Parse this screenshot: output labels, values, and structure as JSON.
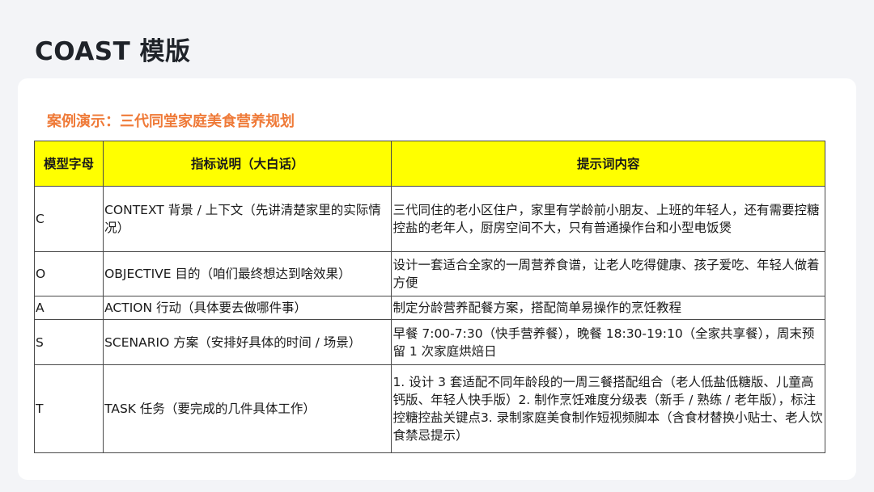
{
  "slide": {
    "title": "COAST 模版",
    "case_title": "案例演示：三代同堂家庭美食营养规划"
  },
  "table": {
    "headers": [
      "模型字母",
      "指标说明（大白话）",
      "提示词内容"
    ],
    "rows": [
      {
        "letter": "C",
        "indicator": "CONTEXT 背景 / 上下文（先讲清楚家里的实际情况）",
        "content": "三代同住的老小区住户，家里有学龄前小朋友、上班的年轻人，还有需要控糖控盐的老年人，厨房空间不大，只有普通操作台和小型电饭煲"
      },
      {
        "letter": "O",
        "indicator": "OBJECTIVE 目的（咱们最终想达到啥效果）",
        "content": "设计一套适合全家的一周营养食谱，让老人吃得健康、孩子爱吃、年轻人做着方便"
      },
      {
        "letter": "A",
        "indicator": "ACTION 行动（具体要去做哪件事）",
        "content": "制定分龄营养配餐方案，搭配简单易操作的烹饪教程"
      },
      {
        "letter": "S",
        "indicator": "SCENARIO 方案（安排好具体的时间 / 场景）",
        "content": "早餐 7:00-7:30（快手营养餐），晚餐 18:30-19:10（全家共享餐），周末预留 1 次家庭烘焙日"
      },
      {
        "letter": "T",
        "indicator": "TASK 任务（要完成的几件具体工作）",
        "content": "1. 设计 3 套适配不同年龄段的一周三餐搭配组合（老人低盐低糖版、儿童高钙版、年轻人快手版）2. 制作烹饪难度分级表（新手 / 熟练 / 老年版），标注控糖控盐关键点3. 录制家庭美食制作短视频脚本（含食材替换小贴士、老人饮食禁忌提示）"
      }
    ]
  }
}
